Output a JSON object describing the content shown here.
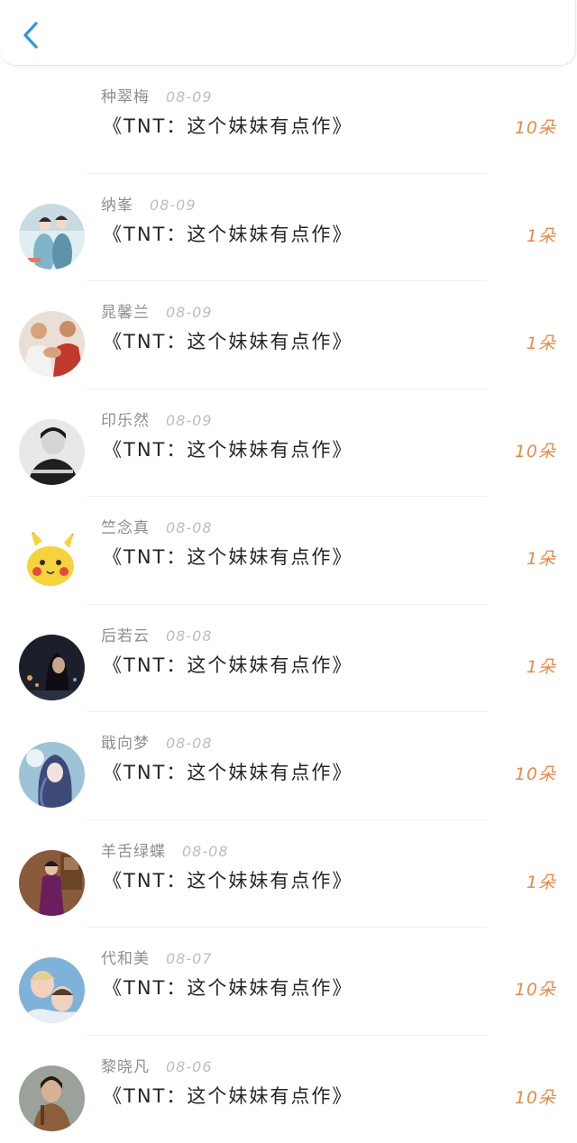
{
  "header": {
    "back_icon": "chevron-left-icon",
    "accent": "#2d98da"
  },
  "colors": {
    "name": "#8e8e8e",
    "date": "#bdbdbd",
    "title": "#262626",
    "count": "#e88a4a"
  },
  "items": [
    {
      "name": "种翠梅",
      "date": "08-09",
      "title": "《TNT：这个妹妹有点作》",
      "count": "10朵",
      "avatar": "none"
    },
    {
      "name": "纳峯",
      "date": "08-09",
      "title": "《TNT：这个妹妹有点作》",
      "count": "1朵",
      "avatar": "ancient-costume-couple"
    },
    {
      "name": "晁馨兰",
      "date": "08-09",
      "title": "《TNT：这个妹妹有点作》",
      "count": "1朵",
      "avatar": "arm-wrestling-photo"
    },
    {
      "name": "印乐然",
      "date": "08-09",
      "title": "《TNT：这个妹妹有点作》",
      "count": "10朵",
      "avatar": "bw-boy-photo"
    },
    {
      "name": "竺念真",
      "date": "08-08",
      "title": "《TNT：这个妹妹有点作》",
      "count": "1朵",
      "avatar": "pikachu"
    },
    {
      "name": "后若云",
      "date": "08-08",
      "title": "《TNT：这个妹妹有点作》",
      "count": "1朵",
      "avatar": "night-girl-photo"
    },
    {
      "name": "戢向梦",
      "date": "08-08",
      "title": "《TNT：这个妹妹有点作》",
      "count": "10朵",
      "avatar": "anime-girl"
    },
    {
      "name": "羊舌绿蝶",
      "date": "08-08",
      "title": "《TNT：这个妹妹有点作》",
      "count": "1朵",
      "avatar": "qipao-woman"
    },
    {
      "name": "代和美",
      "date": "08-07",
      "title": "《TNT：这个妹妹有点作》",
      "count": "10朵",
      "avatar": "two-people-photo"
    },
    {
      "name": "黎晓凡",
      "date": "08-06",
      "title": "《TNT：这个妹妹有点作》",
      "count": "10朵",
      "avatar": "actress-photo"
    }
  ]
}
